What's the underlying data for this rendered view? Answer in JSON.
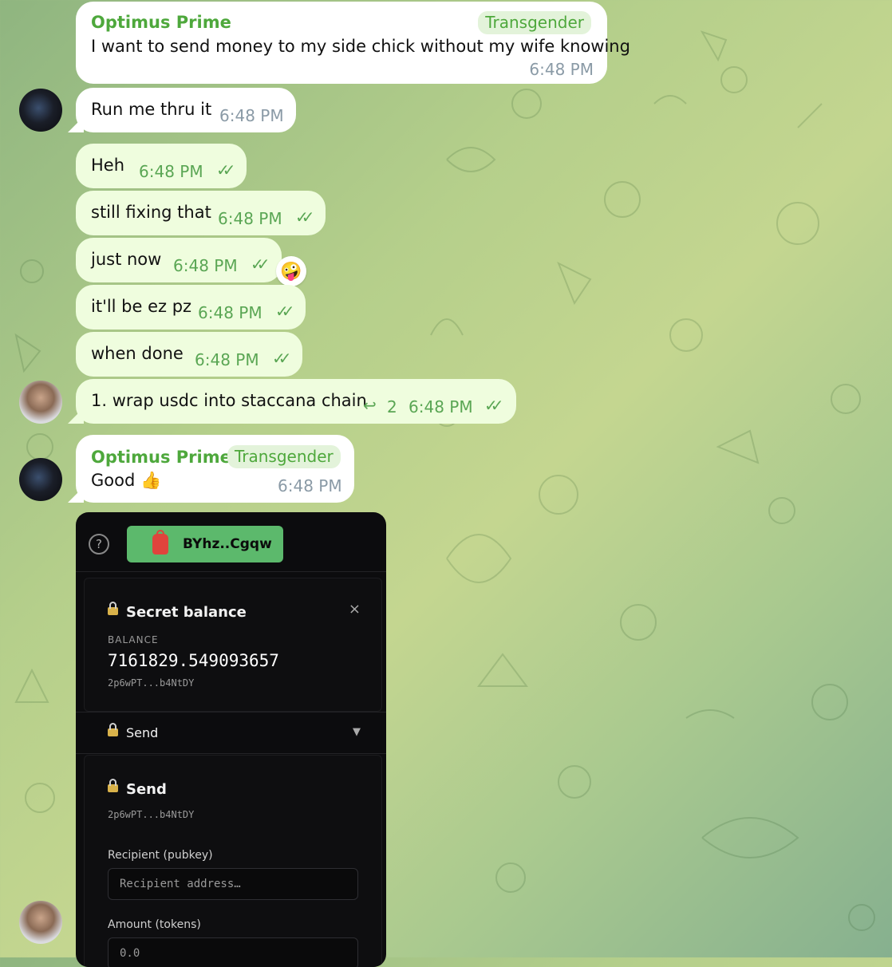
{
  "messages": {
    "m1": {
      "sender": "Optimus Prime",
      "role": "Transgender",
      "text": "I want to send money to my side chick without my wife knowing",
      "time": "6:48 PM"
    },
    "m2": {
      "text": "Run me thru it",
      "time": "6:48 PM"
    },
    "m3": {
      "text": "Heh",
      "time": "6:48 PM"
    },
    "m4": {
      "text": "still fixing that",
      "time": "6:48 PM"
    },
    "m5": {
      "text": "just now",
      "time": "6:48 PM",
      "reaction": "🤪"
    },
    "m6": {
      "text": "it'll be ez pz",
      "time": "6:48 PM"
    },
    "m7": {
      "text": "when done",
      "time": "6:48 PM"
    },
    "m8": {
      "text": "1. wrap usdc into staccana chain",
      "replies": "2",
      "time": "6:48 PM"
    },
    "m9": {
      "sender": "Optimus Prime",
      "role": "Transgender",
      "text": "Good 👍",
      "time": "6:48 PM"
    }
  },
  "wallet": {
    "help": "?",
    "address_button": "BYhz..Cgqw",
    "balance_panel": {
      "title": "Secret balance",
      "close": "×",
      "label": "BALANCE",
      "amount": "7161829.549093657",
      "pubkey": "2p6wPT...b4NtDY"
    },
    "send_section": {
      "label": "Send",
      "chevron": "▼"
    },
    "send_form": {
      "title": "Send",
      "pubkey": "2p6wPT...b4NtDY",
      "recipient_label": "Recipient (pubkey)",
      "recipient_placeholder": "Recipient address…",
      "amount_label": "Amount (tokens)",
      "amount_placeholder": "0.0"
    }
  }
}
